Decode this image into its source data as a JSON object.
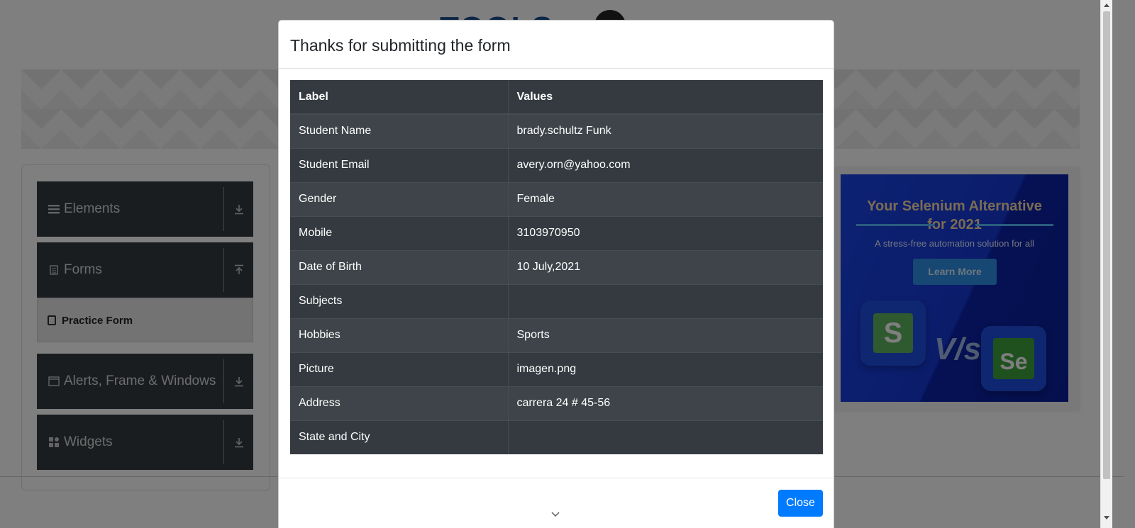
{
  "background": {
    "logo": {
      "text": "TOOLS"
    },
    "sidebar": {
      "groups": [
        {
          "label": "Elements",
          "icon": "hamburger-icon",
          "arrow": "download-arrow-icon"
        },
        {
          "label": "Forms",
          "icon": "document-icon",
          "arrow": "upload-arrow-icon"
        },
        {
          "label": "Alerts, Frame & Windows",
          "icon": "window-icon",
          "arrow": "download-arrow-icon"
        },
        {
          "label": "Widgets",
          "icon": "widgets-icon",
          "arrow": "download-arrow-icon"
        }
      ],
      "active_item": {
        "label": "Practice Form",
        "icon": "html-badge-icon"
      }
    },
    "ad": {
      "title_line1": "Your Selenium Alternative",
      "title_line2": "for 2021",
      "subtitle": "A stress-free automation solution for all",
      "button": "Learn More",
      "vs": "V/s",
      "tile_left_letter": "S",
      "tile_right_letters": "Se"
    }
  },
  "modal": {
    "title": "Thanks for submitting the form",
    "table": {
      "headers": [
        "Label",
        "Values"
      ],
      "rows": [
        [
          "Student Name",
          "brady.schultz Funk"
        ],
        [
          "Student Email",
          "avery.orn@yahoo.com"
        ],
        [
          "Gender",
          "Female"
        ],
        [
          "Mobile",
          "3103970950"
        ],
        [
          "Date of Birth",
          "10 July,2021"
        ],
        [
          "Subjects",
          ""
        ],
        [
          "Hobbies",
          "Sports"
        ],
        [
          "Picture",
          "imagen.png"
        ],
        [
          "Address",
          "carrera 24 # 45-56"
        ],
        [
          "State and City",
          ""
        ]
      ]
    },
    "close_button": "Close",
    "scroll_hint_icon": "chevron-down-icon"
  },
  "colors": {
    "table_bg": "#343a40",
    "primary_button": "#007bff",
    "sidebar_header": "#343a40",
    "ad_blue": "#1b44e6"
  }
}
